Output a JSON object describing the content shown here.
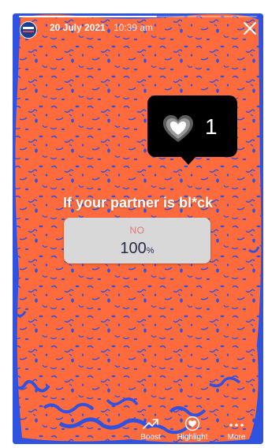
{
  "story": {
    "date": "20 July 2021",
    "time": "10:39 am",
    "progress": 0.58
  },
  "likes": {
    "count": "1",
    "icon": "heart-icon"
  },
  "poll": {
    "question": "If your partner is bl*ck",
    "option_label": "NO",
    "result_value": "100",
    "result_unit": "%"
  },
  "actions": {
    "boost_label": "Boost",
    "highlight_label": "Highlight",
    "more_label": "More"
  },
  "colors": {
    "background_orange": "#ff6b3d",
    "background_blue": "#2f52e0",
    "poll_option_pink": "#ef6f6f"
  }
}
